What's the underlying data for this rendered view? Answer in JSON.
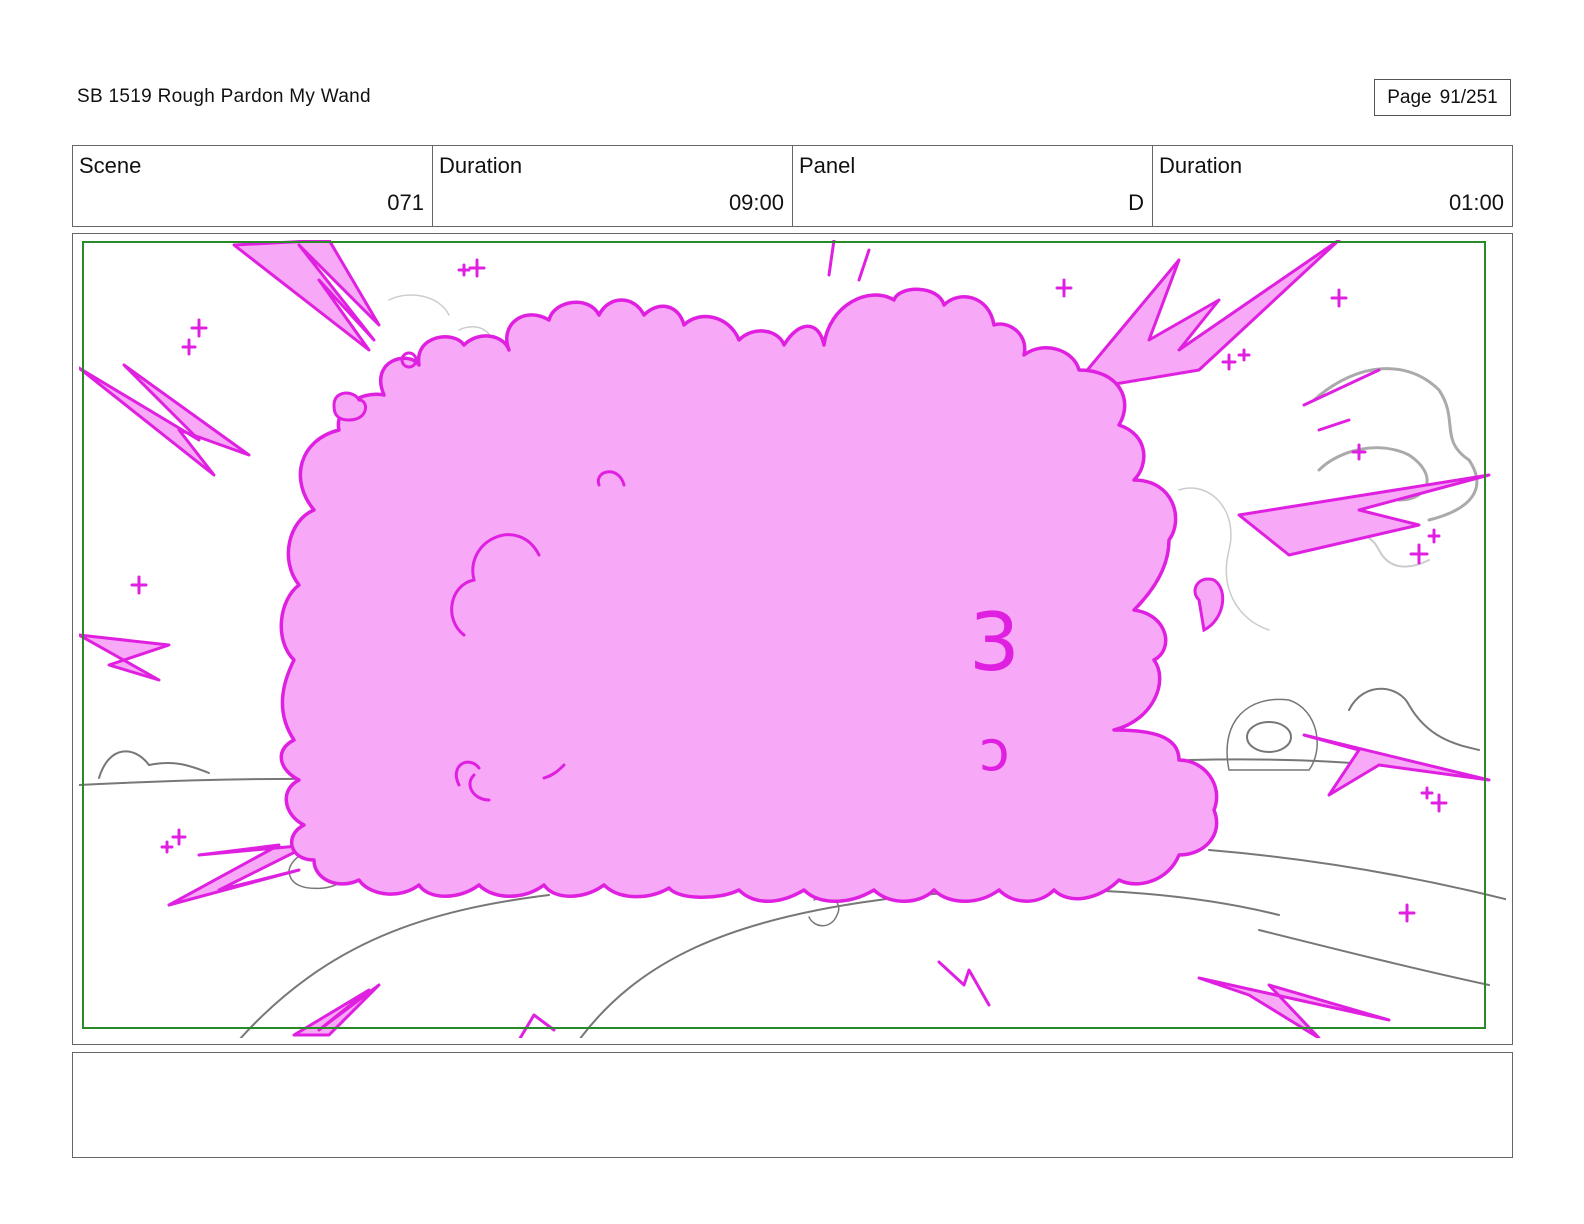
{
  "header": {
    "title": "SB 1519 Rough  Pardon My Wand",
    "page_label": "Page",
    "page_number": "91/251"
  },
  "info": {
    "scene_label": "Scene",
    "scene_value": "071",
    "scene_duration_label": "Duration",
    "scene_duration_value": "09:00",
    "panel_label": "Panel",
    "panel_value": "D",
    "panel_duration_label": "Duration",
    "panel_duration_value": "01:00"
  },
  "panel": {
    "annotation_glyph_1": "3",
    "annotation_glyph_2": "ɔ",
    "colors": {
      "effect_magenta": "#e020e0",
      "effect_pink_fill": "#f7a8f7",
      "safe_frame_green": "#2a8a2a",
      "pencil_gray": "#777777"
    }
  },
  "caption": {
    "text": ""
  }
}
